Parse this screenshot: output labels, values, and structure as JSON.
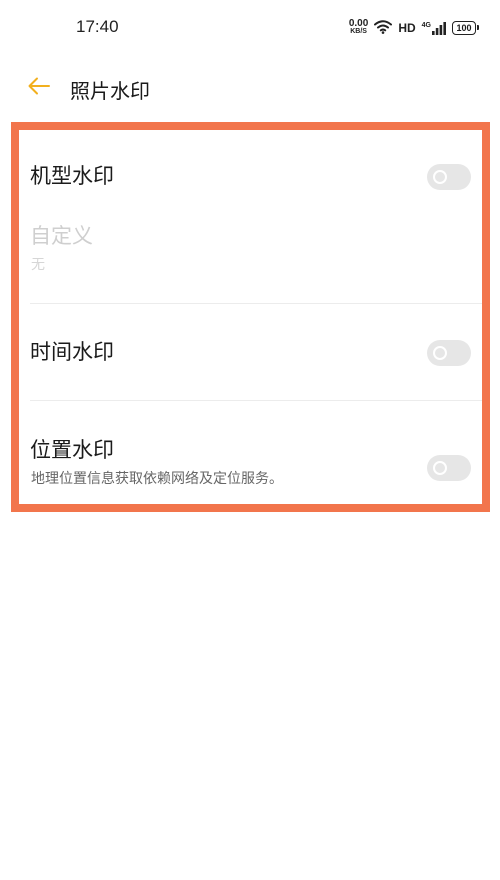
{
  "status_bar": {
    "time": "17:40",
    "net_speed_value": "0.00",
    "net_speed_unit": "KB/S",
    "hd": "HD",
    "signal_label": "4G",
    "battery": "100"
  },
  "header": {
    "title": "照片水印"
  },
  "settings": {
    "model_watermark": {
      "label": "机型水印",
      "enabled": false
    },
    "custom": {
      "label": "自定义",
      "value": "无"
    },
    "time_watermark": {
      "label": "时间水印",
      "enabled": false
    },
    "location_watermark": {
      "label": "位置水印",
      "description": "地理位置信息获取依赖网络及定位服务。",
      "enabled": false
    }
  },
  "colors": {
    "accent": "#f2b01e",
    "highlight_border": "#f2754c",
    "toggle_off": "#e6e6e6"
  }
}
